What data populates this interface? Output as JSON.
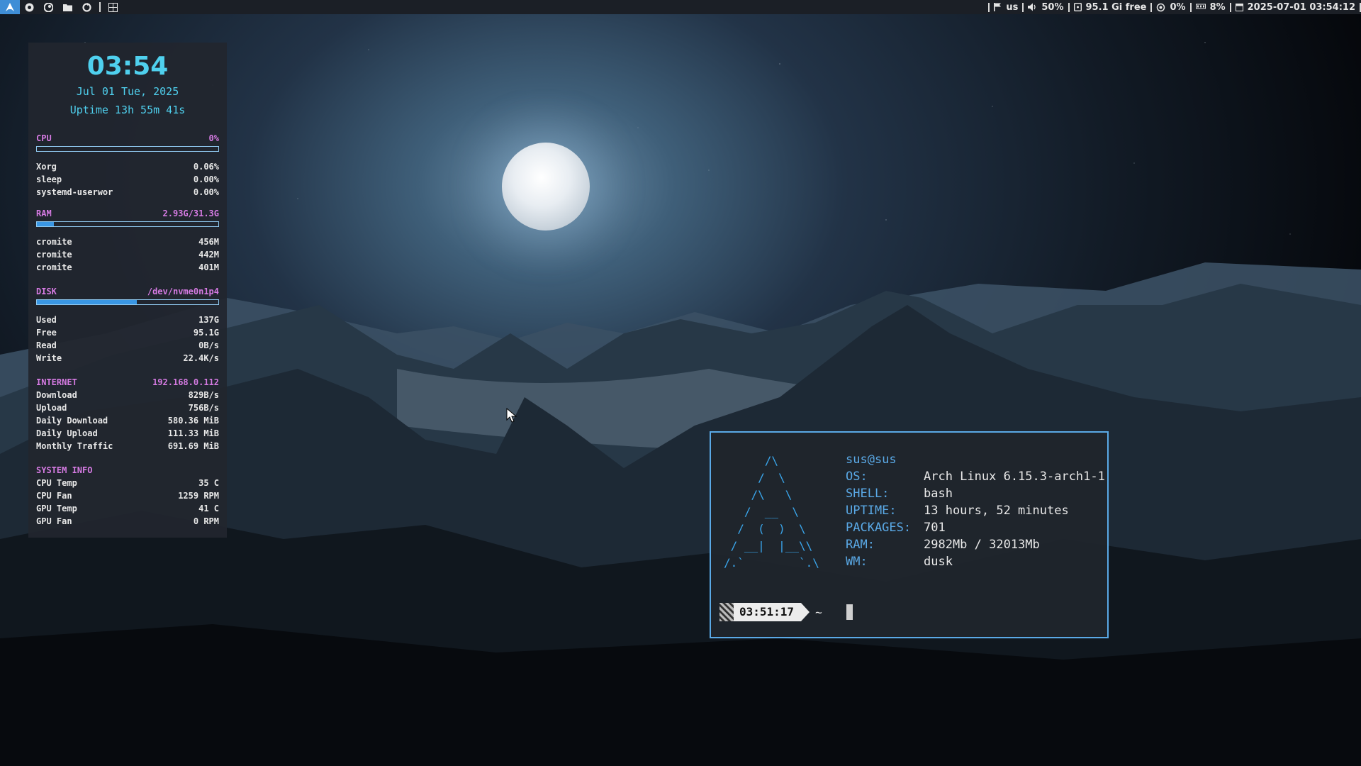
{
  "topbar": {
    "left_icons": [
      "arch-logo-icon",
      "chromium-icon",
      "steam-icon",
      "folder-icon",
      "refresh-icon",
      "grid-icon"
    ],
    "keyboard_layout": "us",
    "volume": "50%",
    "disk_free": "95.1 Gi free",
    "cpu": "0%",
    "ram": "8%",
    "datetime": "2025-07-01 03:54:12"
  },
  "conky": {
    "clock": "03:54",
    "date": "Jul 01 Tue, 2025",
    "uptime": "Uptime 13h 55m 41s",
    "cpu": {
      "label": "CPU",
      "value": "0%",
      "bar_fraction": 0.0,
      "processes": [
        {
          "name": "Xorg",
          "value": "0.06%"
        },
        {
          "name": "sleep",
          "value": "0.00%"
        },
        {
          "name": "systemd-userwor",
          "value": "0.00%"
        }
      ]
    },
    "ram": {
      "label": "RAM",
      "value": "2.93G/31.3G",
      "bar_fraction": 0.094,
      "processes": [
        {
          "name": "cromite",
          "value": "456M"
        },
        {
          "name": "cromite",
          "value": "442M"
        },
        {
          "name": "cromite",
          "value": "401M"
        }
      ]
    },
    "disk": {
      "label": "DISK",
      "value": "/dev/nvme0n1p4",
      "bar_fraction": 0.55,
      "rows": [
        {
          "name": "Used",
          "value": "137G"
        },
        {
          "name": "Free",
          "value": "95.1G"
        },
        {
          "name": "Read",
          "value": "0B/s"
        },
        {
          "name": "Write",
          "value": "22.4K/s"
        }
      ]
    },
    "internet": {
      "label": "INTERNET",
      "value": "192.168.0.112",
      "rows": [
        {
          "name": "Download",
          "value": "829B/s"
        },
        {
          "name": "Upload",
          "value": "756B/s"
        },
        {
          "name": "Daily Download",
          "value": "580.36 MiB"
        },
        {
          "name": "Daily Upload",
          "value": "111.33 MiB"
        },
        {
          "name": "Monthly Traffic",
          "value": "691.69 MiB"
        }
      ]
    },
    "system_info": {
      "label": "SYSTEM INFO",
      "rows": [
        {
          "name": "CPU Temp",
          "value": "35 C"
        },
        {
          "name": "CPU Fan",
          "value": "1259 RPM"
        },
        {
          "name": "GPU Temp",
          "value": "41 C"
        },
        {
          "name": "GPU Fan",
          "value": "0 RPM"
        }
      ]
    }
  },
  "terminal": {
    "ascii_art": "      /\\\n     /  \\\n    /\\   \\\n   /  __  \\\n  /  (  )  \\\n / __|  |__\\\\\n/.`        `.\\",
    "user_host": "sus@sus",
    "fetch": [
      {
        "key": "OS:",
        "value": "Arch Linux 6.15.3-arch1-1"
      },
      {
        "key": "SHELL:",
        "value": "bash"
      },
      {
        "key": "UPTIME:",
        "value": "13 hours, 52 minutes"
      },
      {
        "key": "PACKAGES:",
        "value": "701"
      },
      {
        "key": "RAM:",
        "value": "2982Mb / 32013Mb"
      },
      {
        "key": "WM:",
        "value": "dusk"
      }
    ],
    "prompt_time": "03:51:17",
    "prompt_dir": "~"
  }
}
